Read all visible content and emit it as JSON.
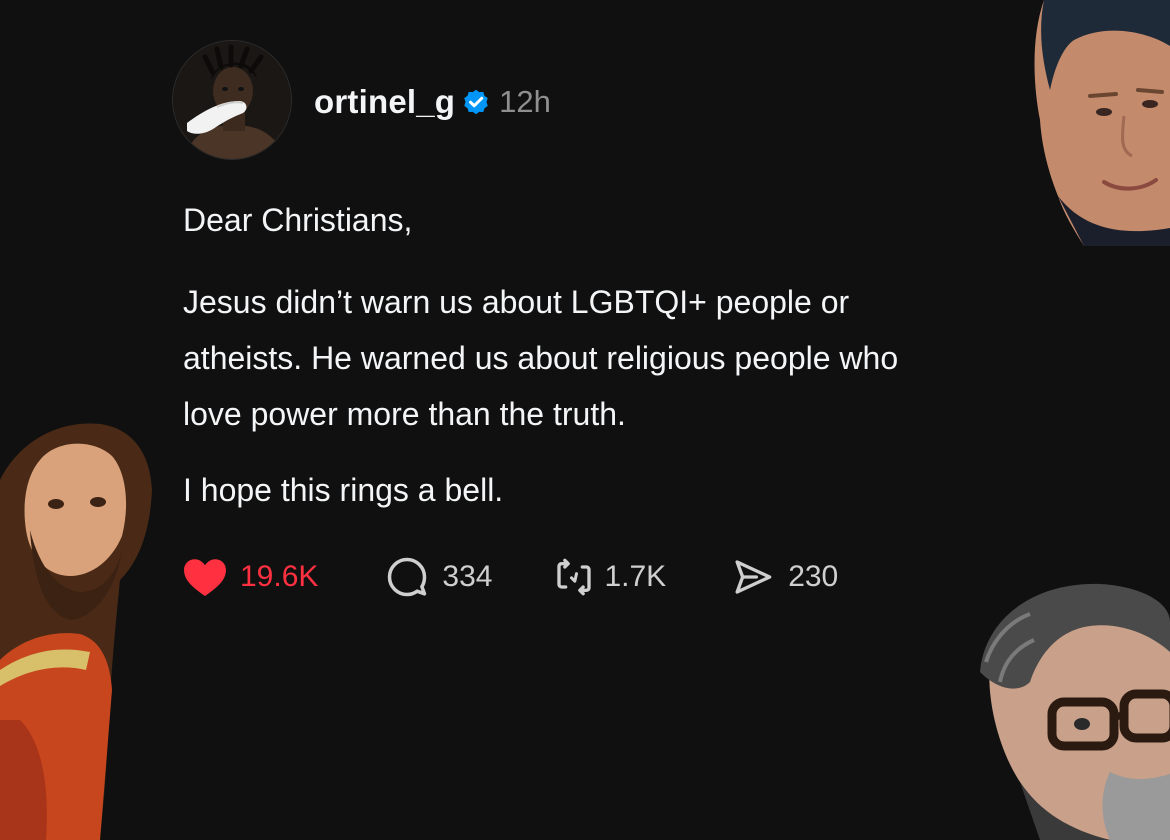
{
  "post": {
    "username": "ortinel_g",
    "verified": true,
    "timestamp": "12h",
    "paragraphs": [
      "Dear Christians,",
      "Jesus didn’t warn us about LGBTQI+ people or",
      "atheists. He warned us about religious people who",
      "love power more than the truth.",
      "I hope this rings a bell."
    ]
  },
  "actions": {
    "likes": "19.6K",
    "replies": "334",
    "reposts": "1.7K",
    "shares": "230"
  },
  "colors": {
    "background": "#101010",
    "text": "#f3f5f7",
    "muted": "#8f8f8f",
    "like": "#ff3040",
    "verified": "#0095f6"
  },
  "icons": {
    "verified": "verified-badge-icon",
    "like": "heart-icon",
    "reply": "comment-bubble-icon",
    "repost": "repost-icon",
    "share": "send-icon"
  }
}
